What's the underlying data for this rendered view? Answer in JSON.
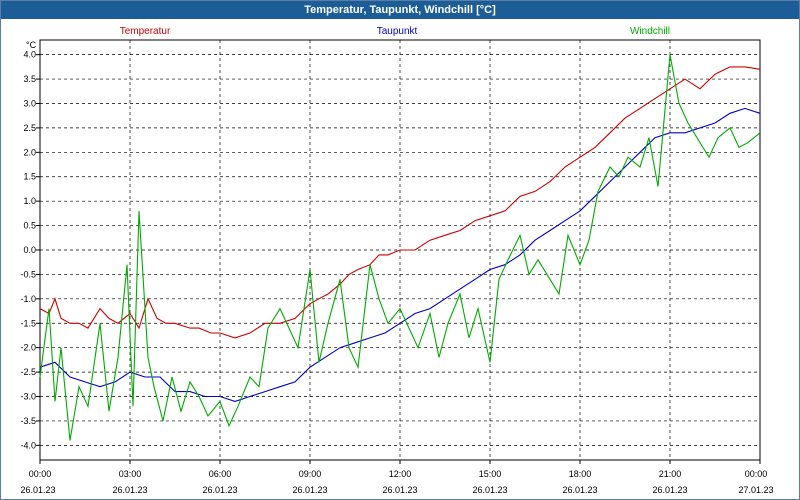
{
  "window": {
    "title": "Temperatur, Taupunkt, Windchill [°C]"
  },
  "chart_data": {
    "type": "line",
    "title": "Temperatur, Taupunkt, Windchill [°C]",
    "ylabel": "°C",
    "xlabel": "",
    "ylim": [
      -4.3,
      4.3
    ],
    "xlim": [
      0,
      24
    ],
    "grid": true,
    "legend_position": "top",
    "y_ticks": [
      "4.0",
      "3.5",
      "3.0",
      "2.5",
      "2.0",
      "1.5",
      "1.0",
      "0.5",
      "0.0",
      "-0.5",
      "-1.0",
      "-1.5",
      "-2.0",
      "-2.5",
      "-3.0",
      "-3.5",
      "-4.0"
    ],
    "x_ticks": [
      {
        "time": "00:00",
        "date": "26.01.23"
      },
      {
        "time": "03:00",
        "date": "26.01.23"
      },
      {
        "time": "06:00",
        "date": "26.01.23"
      },
      {
        "time": "09:00",
        "date": "26.01.23"
      },
      {
        "time": "12:00",
        "date": "26.01.23"
      },
      {
        "time": "15:00",
        "date": "26.01.23"
      },
      {
        "time": "18:00",
        "date": "26.01.23"
      },
      {
        "time": "21:00",
        "date": "26.01.23"
      },
      {
        "time": "00:00",
        "date": "27.01.23"
      }
    ],
    "series": [
      {
        "name": "Temperatur",
        "color": "#cc0000",
        "x": [
          0,
          0.3,
          0.5,
          0.7,
          1,
          1.3,
          1.6,
          2,
          2.3,
          2.6,
          3,
          3.3,
          3.6,
          3.9,
          4.2,
          4.5,
          5,
          5.3,
          5.7,
          6,
          6.5,
          7,
          7.5,
          8,
          8.5,
          9,
          9.3,
          9.6,
          10,
          10.3,
          10.6,
          11,
          11.3,
          11.6,
          12,
          12.5,
          13,
          13.5,
          14,
          14.5,
          15,
          15.5,
          16,
          16.5,
          17,
          17.5,
          18,
          18.5,
          19,
          19.5,
          20,
          20.5,
          21,
          21.5,
          22,
          22.5,
          23,
          23.5,
          24
        ],
        "values": [
          -1.2,
          -1.3,
          -1.0,
          -1.4,
          -1.5,
          -1.5,
          -1.6,
          -1.2,
          -1.4,
          -1.5,
          -1.3,
          -1.6,
          -1.0,
          -1.4,
          -1.5,
          -1.5,
          -1.6,
          -1.6,
          -1.7,
          -1.7,
          -1.8,
          -1.7,
          -1.5,
          -1.5,
          -1.4,
          -1.1,
          -1.0,
          -0.9,
          -0.7,
          -0.5,
          -0.4,
          -0.3,
          -0.1,
          -0.1,
          0.0,
          0.0,
          0.2,
          0.3,
          0.4,
          0.6,
          0.7,
          0.8,
          1.1,
          1.2,
          1.4,
          1.7,
          1.9,
          2.1,
          2.4,
          2.7,
          2.9,
          3.1,
          3.3,
          3.5,
          3.3,
          3.6,
          3.75,
          3.75,
          3.7
        ]
      },
      {
        "name": "Taupunkt",
        "color": "#0000cc",
        "x": [
          0,
          0.5,
          1,
          1.5,
          2,
          2.5,
          3,
          3.5,
          4,
          4.5,
          5,
          5.5,
          6,
          6.5,
          7,
          7.5,
          8,
          8.5,
          9,
          9.5,
          10,
          10.5,
          11,
          11.5,
          12,
          12.5,
          13,
          13.5,
          14,
          14.5,
          15,
          15.5,
          16,
          16.5,
          17,
          17.5,
          18,
          18.5,
          19,
          19.5,
          20,
          20.5,
          21,
          21.5,
          22,
          22.5,
          23,
          23.5,
          24
        ],
        "values": [
          -2.4,
          -2.3,
          -2.6,
          -2.7,
          -2.8,
          -2.7,
          -2.5,
          -2.6,
          -2.6,
          -2.9,
          -2.9,
          -3.0,
          -3.0,
          -3.1,
          -3.0,
          -2.9,
          -2.8,
          -2.7,
          -2.4,
          -2.2,
          -2.0,
          -1.9,
          -1.8,
          -1.7,
          -1.5,
          -1.3,
          -1.2,
          -1.0,
          -0.8,
          -0.6,
          -0.4,
          -0.3,
          -0.1,
          0.2,
          0.4,
          0.6,
          0.8,
          1.1,
          1.4,
          1.7,
          2.0,
          2.3,
          2.4,
          2.4,
          2.5,
          2.6,
          2.8,
          2.9,
          2.8
        ]
      },
      {
        "name": "Windchill",
        "color": "#00aa00",
        "x": [
          0,
          0.3,
          0.5,
          0.7,
          1,
          1.3,
          1.6,
          2,
          2.3,
          2.6,
          2.9,
          3.1,
          3.3,
          3.6,
          3.8,
          4.1,
          4.4,
          4.7,
          5,
          5.3,
          5.6,
          6,
          6.3,
          6.6,
          7,
          7.3,
          7.6,
          8,
          8.3,
          8.6,
          9,
          9.3,
          9.6,
          10,
          10.3,
          10.6,
          11,
          11.3,
          11.6,
          12,
          12.3,
          12.6,
          13,
          13.3,
          13.6,
          14,
          14.3,
          14.6,
          15,
          15.3,
          15.6,
          16,
          16.3,
          16.6,
          17,
          17.3,
          17.6,
          18,
          18.3,
          18.6,
          19,
          19.3,
          19.6,
          20,
          20.3,
          20.6,
          21,
          21.3,
          21.6,
          22,
          22.3,
          22.6,
          23,
          23.3,
          23.6,
          24
        ],
        "values": [
          -2.6,
          -1.2,
          -3.1,
          -2.0,
          -3.9,
          -2.8,
          -3.2,
          -1.5,
          -3.3,
          -2.2,
          -0.3,
          -3.2,
          0.8,
          -2.2,
          -2.8,
          -3.5,
          -2.6,
          -3.3,
          -2.7,
          -3.0,
          -3.4,
          -3.1,
          -3.6,
          -3.2,
          -2.6,
          -2.8,
          -1.6,
          -1.2,
          -1.6,
          -2.0,
          -0.4,
          -2.3,
          -1.5,
          -0.6,
          -2.0,
          -2.4,
          -0.3,
          -1.0,
          -1.5,
          -1.2,
          -1.6,
          -2.0,
          -1.3,
          -2.2,
          -1.5,
          -0.9,
          -1.8,
          -1.2,
          -2.3,
          -0.6,
          -0.2,
          0.3,
          -0.5,
          -0.2,
          -0.6,
          -0.9,
          0.3,
          -0.3,
          0.2,
          1.2,
          1.7,
          1.5,
          1.9,
          1.7,
          2.3,
          1.3,
          4.0,
          3.0,
          2.6,
          2.2,
          1.9,
          2.3,
          2.5,
          2.1,
          2.2,
          2.4
        ]
      }
    ]
  }
}
